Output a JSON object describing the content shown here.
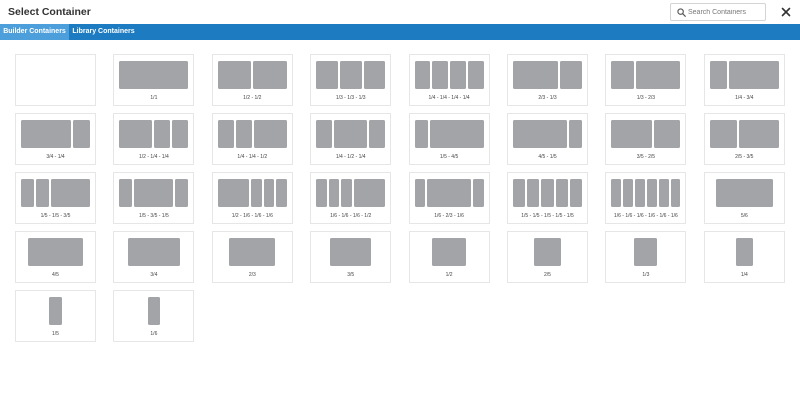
{
  "header": {
    "title": "Select Container",
    "search_placeholder": "Search Containers",
    "search_value": ""
  },
  "tabs": [
    {
      "label": "Builder Containers",
      "active": true
    },
    {
      "label": "Library Containers",
      "active": false
    }
  ],
  "colors": {
    "tab_bar": "#1c7bc1",
    "tab_active": "#4c9fdb",
    "column_block": "#a2a4a8"
  },
  "icons": {
    "search": "search-icon",
    "close": "close-icon"
  },
  "containers": [
    {
      "label": "",
      "cols": []
    },
    {
      "label": "1/1",
      "cols": [
        1
      ]
    },
    {
      "label": "1/2 - 1/2",
      "cols": [
        0.5,
        0.5
      ]
    },
    {
      "label": "1/3 - 1/3 - 1/3",
      "cols": [
        0.3333,
        0.3333,
        0.3333
      ]
    },
    {
      "label": "1/4 - 1/4 - 1/4 - 1/4",
      "cols": [
        0.25,
        0.25,
        0.25,
        0.25
      ]
    },
    {
      "label": "2/3 - 1/3",
      "cols": [
        0.6667,
        0.3333
      ]
    },
    {
      "label": "1/3 - 2/3",
      "cols": [
        0.3333,
        0.6667
      ]
    },
    {
      "label": "1/4 - 3/4",
      "cols": [
        0.25,
        0.75
      ]
    },
    {
      "label": "3/4 - 1/4",
      "cols": [
        0.75,
        0.25
      ]
    },
    {
      "label": "1/2 - 1/4 - 1/4",
      "cols": [
        0.5,
        0.25,
        0.25
      ]
    },
    {
      "label": "1/4 - 1/4 - 1/2",
      "cols": [
        0.25,
        0.25,
        0.5
      ]
    },
    {
      "label": "1/4 - 1/2 - 1/4",
      "cols": [
        0.25,
        0.5,
        0.25
      ]
    },
    {
      "label": "1/5 - 4/5",
      "cols": [
        0.2,
        0.8
      ]
    },
    {
      "label": "4/5 - 1/5",
      "cols": [
        0.8,
        0.2
      ]
    },
    {
      "label": "3/5 - 2/5",
      "cols": [
        0.6,
        0.4
      ]
    },
    {
      "label": "2/5 - 3/5",
      "cols": [
        0.4,
        0.6
      ]
    },
    {
      "label": "1/5 - 1/5 - 3/5",
      "cols": [
        0.2,
        0.2,
        0.6
      ]
    },
    {
      "label": "1/5 - 3/5 - 1/5",
      "cols": [
        0.2,
        0.6,
        0.2
      ]
    },
    {
      "label": "1/2 - 1/6 - 1/6 - 1/6",
      "cols": [
        0.5,
        0.1667,
        0.1667,
        0.1667
      ]
    },
    {
      "label": "1/6 - 1/6 - 1/6 - 1/2",
      "cols": [
        0.1667,
        0.1667,
        0.1667,
        0.5
      ]
    },
    {
      "label": "1/6 - 2/3 - 1/6",
      "cols": [
        0.1667,
        0.6667,
        0.1667
      ]
    },
    {
      "label": "1/5 - 1/5 - 1/5 - 1/5 - 1/5",
      "cols": [
        0.2,
        0.2,
        0.2,
        0.2,
        0.2
      ]
    },
    {
      "label": "1/6 - 1/6 - 1/6 - 1/6 - 1/6 - 1/6",
      "cols": [
        0.1667,
        0.1667,
        0.1667,
        0.1667,
        0.1667,
        0.1667
      ]
    },
    {
      "label": "5/6",
      "cols": [
        0.8333
      ]
    },
    {
      "label": "4/5",
      "cols": [
        0.8
      ]
    },
    {
      "label": "3/4",
      "cols": [
        0.75
      ]
    },
    {
      "label": "2/3",
      "cols": [
        0.6667
      ]
    },
    {
      "label": "3/5",
      "cols": [
        0.6
      ]
    },
    {
      "label": "1/2",
      "cols": [
        0.5
      ]
    },
    {
      "label": "2/5",
      "cols": [
        0.4
      ]
    },
    {
      "label": "1/3",
      "cols": [
        0.3333
      ]
    },
    {
      "label": "1/4",
      "cols": [
        0.25
      ]
    },
    {
      "label": "1/5",
      "cols": [
        0.2
      ]
    },
    {
      "label": "1/6",
      "cols": [
        0.1667
      ]
    }
  ]
}
